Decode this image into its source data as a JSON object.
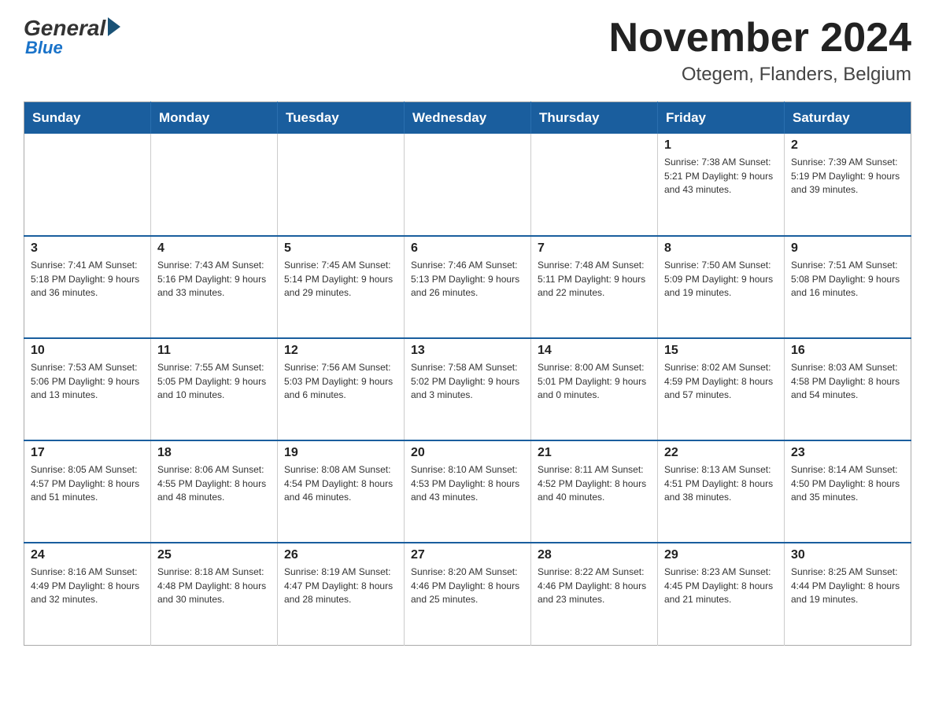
{
  "header": {
    "logo_general": "General",
    "logo_blue": "Blue",
    "month_title": "November 2024",
    "location": "Otegem, Flanders, Belgium"
  },
  "calendar": {
    "days_of_week": [
      "Sunday",
      "Monday",
      "Tuesday",
      "Wednesday",
      "Thursday",
      "Friday",
      "Saturday"
    ],
    "weeks": [
      [
        {
          "day": "",
          "info": ""
        },
        {
          "day": "",
          "info": ""
        },
        {
          "day": "",
          "info": ""
        },
        {
          "day": "",
          "info": ""
        },
        {
          "day": "",
          "info": ""
        },
        {
          "day": "1",
          "info": "Sunrise: 7:38 AM\nSunset: 5:21 PM\nDaylight: 9 hours\nand 43 minutes."
        },
        {
          "day": "2",
          "info": "Sunrise: 7:39 AM\nSunset: 5:19 PM\nDaylight: 9 hours\nand 39 minutes."
        }
      ],
      [
        {
          "day": "3",
          "info": "Sunrise: 7:41 AM\nSunset: 5:18 PM\nDaylight: 9 hours\nand 36 minutes."
        },
        {
          "day": "4",
          "info": "Sunrise: 7:43 AM\nSunset: 5:16 PM\nDaylight: 9 hours\nand 33 minutes."
        },
        {
          "day": "5",
          "info": "Sunrise: 7:45 AM\nSunset: 5:14 PM\nDaylight: 9 hours\nand 29 minutes."
        },
        {
          "day": "6",
          "info": "Sunrise: 7:46 AM\nSunset: 5:13 PM\nDaylight: 9 hours\nand 26 minutes."
        },
        {
          "day": "7",
          "info": "Sunrise: 7:48 AM\nSunset: 5:11 PM\nDaylight: 9 hours\nand 22 minutes."
        },
        {
          "day": "8",
          "info": "Sunrise: 7:50 AM\nSunset: 5:09 PM\nDaylight: 9 hours\nand 19 minutes."
        },
        {
          "day": "9",
          "info": "Sunrise: 7:51 AM\nSunset: 5:08 PM\nDaylight: 9 hours\nand 16 minutes."
        }
      ],
      [
        {
          "day": "10",
          "info": "Sunrise: 7:53 AM\nSunset: 5:06 PM\nDaylight: 9 hours\nand 13 minutes."
        },
        {
          "day": "11",
          "info": "Sunrise: 7:55 AM\nSunset: 5:05 PM\nDaylight: 9 hours\nand 10 minutes."
        },
        {
          "day": "12",
          "info": "Sunrise: 7:56 AM\nSunset: 5:03 PM\nDaylight: 9 hours\nand 6 minutes."
        },
        {
          "day": "13",
          "info": "Sunrise: 7:58 AM\nSunset: 5:02 PM\nDaylight: 9 hours\nand 3 minutes."
        },
        {
          "day": "14",
          "info": "Sunrise: 8:00 AM\nSunset: 5:01 PM\nDaylight: 9 hours\nand 0 minutes."
        },
        {
          "day": "15",
          "info": "Sunrise: 8:02 AM\nSunset: 4:59 PM\nDaylight: 8 hours\nand 57 minutes."
        },
        {
          "day": "16",
          "info": "Sunrise: 8:03 AM\nSunset: 4:58 PM\nDaylight: 8 hours\nand 54 minutes."
        }
      ],
      [
        {
          "day": "17",
          "info": "Sunrise: 8:05 AM\nSunset: 4:57 PM\nDaylight: 8 hours\nand 51 minutes."
        },
        {
          "day": "18",
          "info": "Sunrise: 8:06 AM\nSunset: 4:55 PM\nDaylight: 8 hours\nand 48 minutes."
        },
        {
          "day": "19",
          "info": "Sunrise: 8:08 AM\nSunset: 4:54 PM\nDaylight: 8 hours\nand 46 minutes."
        },
        {
          "day": "20",
          "info": "Sunrise: 8:10 AM\nSunset: 4:53 PM\nDaylight: 8 hours\nand 43 minutes."
        },
        {
          "day": "21",
          "info": "Sunrise: 8:11 AM\nSunset: 4:52 PM\nDaylight: 8 hours\nand 40 minutes."
        },
        {
          "day": "22",
          "info": "Sunrise: 8:13 AM\nSunset: 4:51 PM\nDaylight: 8 hours\nand 38 minutes."
        },
        {
          "day": "23",
          "info": "Sunrise: 8:14 AM\nSunset: 4:50 PM\nDaylight: 8 hours\nand 35 minutes."
        }
      ],
      [
        {
          "day": "24",
          "info": "Sunrise: 8:16 AM\nSunset: 4:49 PM\nDaylight: 8 hours\nand 32 minutes."
        },
        {
          "day": "25",
          "info": "Sunrise: 8:18 AM\nSunset: 4:48 PM\nDaylight: 8 hours\nand 30 minutes."
        },
        {
          "day": "26",
          "info": "Sunrise: 8:19 AM\nSunset: 4:47 PM\nDaylight: 8 hours\nand 28 minutes."
        },
        {
          "day": "27",
          "info": "Sunrise: 8:20 AM\nSunset: 4:46 PM\nDaylight: 8 hours\nand 25 minutes."
        },
        {
          "day": "28",
          "info": "Sunrise: 8:22 AM\nSunset: 4:46 PM\nDaylight: 8 hours\nand 23 minutes."
        },
        {
          "day": "29",
          "info": "Sunrise: 8:23 AM\nSunset: 4:45 PM\nDaylight: 8 hours\nand 21 minutes."
        },
        {
          "day": "30",
          "info": "Sunrise: 8:25 AM\nSunset: 4:44 PM\nDaylight: 8 hours\nand 19 minutes."
        }
      ]
    ]
  }
}
